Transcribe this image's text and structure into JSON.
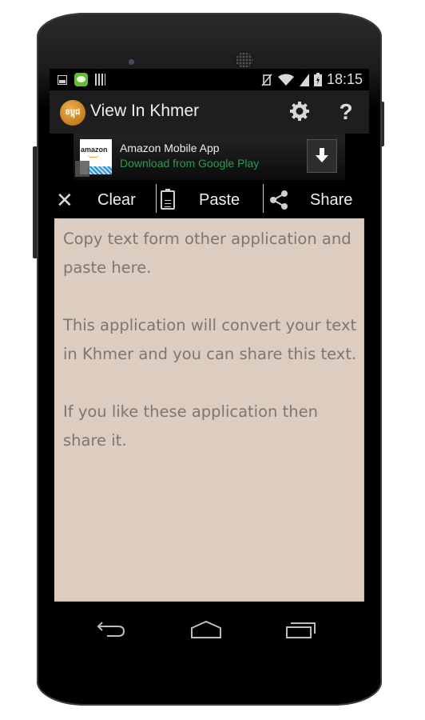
{
  "status_bar": {
    "left_icons": [
      "image-notification-icon",
      "line-app-icon",
      "barcode-icon"
    ],
    "right_icons": [
      "vibrate-off-icon",
      "wifi-icon",
      "signal-icon",
      "battery-charging-icon"
    ],
    "time": "18:15"
  },
  "action_bar": {
    "logo_text": "ខម្ពុជ",
    "title": "View In Khmer",
    "settings_icon": "gear-icon",
    "help_label": "?"
  },
  "ad_banner": {
    "icon_text": "amazon",
    "title": "Amazon Mobile App",
    "subtitle": "Download from Google Play",
    "download_glyph": "⬇",
    "subtitle_color": "#2f9a4a"
  },
  "toolbar": {
    "clear_label": "Clear",
    "clear_glyph": "✕",
    "paste_label": "Paste",
    "share_label": "Share"
  },
  "content": {
    "background_color": "#dccdc0",
    "text": "Copy text form other application and paste here.\n\nThis application will convert your text in Khmer and you can share this text.\n\nIf you like these application then share it."
  },
  "nav_bar": {
    "buttons": [
      "back",
      "home",
      "recent-apps"
    ]
  }
}
